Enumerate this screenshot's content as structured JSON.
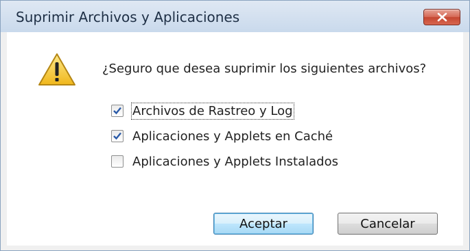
{
  "window": {
    "title": "Suprimir Archivos y Aplicaciones",
    "close_icon": "close-x-icon"
  },
  "dialog": {
    "icon": "warning-icon",
    "question": "¿Seguro que desea suprimir los siguientes archivos?",
    "options": [
      {
        "label": "Archivos de Rastreo y Log",
        "checked": true
      },
      {
        "label": "Aplicaciones y Applets en Caché",
        "checked": true
      },
      {
        "label": "Aplicaciones y Applets Instalados",
        "checked": false
      }
    ],
    "buttons": {
      "accept": "Aceptar",
      "cancel": "Cancelar"
    }
  },
  "colors": {
    "close_button": "#c54732",
    "warning": "#f3c52b",
    "checkmark": "#2a5aa8",
    "default_button_border": "#3c7fb1"
  }
}
